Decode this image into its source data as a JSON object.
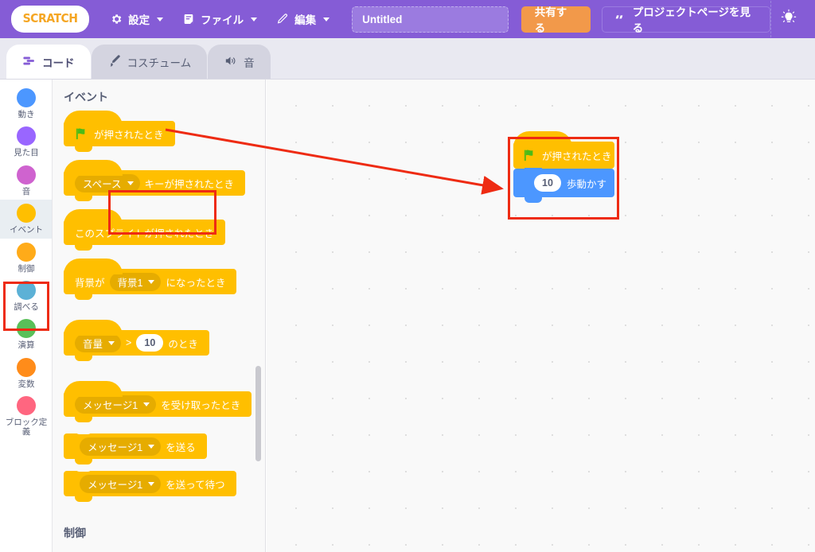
{
  "menubar": {
    "logo": "SCRATCH",
    "items": [
      {
        "label": "設定",
        "icon": "gear-icon"
      },
      {
        "label": "ファイル",
        "icon": "file-icon"
      },
      {
        "label": "編集",
        "icon": "pencil-icon"
      }
    ],
    "project_title": "Untitled",
    "project_title_placeholder": "Untitled",
    "share_label": "共有する",
    "project_page_label": "プロジェクトページを見る",
    "bulb_icon": "lightbulb-icon",
    "bg_color": "#855CD6",
    "share_color": "#F2994A"
  },
  "tabs": [
    {
      "label": "コード",
      "icon": "code-icon",
      "active": true
    },
    {
      "label": "コスチューム",
      "icon": "brush-icon",
      "active": false
    },
    {
      "label": "音",
      "icon": "speaker-icon",
      "active": false
    }
  ],
  "categories": [
    {
      "label": "動き",
      "color": "#4C97FF"
    },
    {
      "label": "見た目",
      "color": "#9966FF"
    },
    {
      "label": "音",
      "color": "#CF63CF"
    },
    {
      "label": "イベント",
      "color": "#FFBF00",
      "selected": true
    },
    {
      "label": "制御",
      "color": "#FFAB19"
    },
    {
      "label": "調べる",
      "color": "#5CB1D6"
    },
    {
      "label": "演算",
      "color": "#59C059"
    },
    {
      "label": "変数",
      "color": "#FF8C1A"
    },
    {
      "label": "ブロック定義",
      "color": "#FF6680"
    }
  ],
  "palette": {
    "header": "イベント",
    "footer_header": "制御",
    "blocks": {
      "flag_clicked": {
        "text": "が押されたとき",
        "icon": "green-flag-icon"
      },
      "key_pressed": {
        "dropdown": "スペース",
        "text": "キーが押されたとき"
      },
      "sprite_clicked": {
        "text": "このスプライトが押されたとき"
      },
      "backdrop_switch": {
        "prefix": "背景が",
        "dropdown": "背景1",
        "suffix": "になったとき"
      },
      "greater_than": {
        "dropdown": "音量",
        "operator": ">",
        "value": "10",
        "suffix": "のとき"
      },
      "receive_message": {
        "dropdown": "メッセージ1",
        "text": "を受け取ったとき"
      },
      "broadcast": {
        "dropdown": "メッセージ1",
        "text": "を送る"
      },
      "broadcast_wait": {
        "dropdown": "メッセージ1",
        "text": "を送って待つ"
      }
    }
  },
  "workspace": {
    "script": {
      "hat": {
        "text": "が押されたとき",
        "icon": "green-flag-icon",
        "color": "#FFBF00"
      },
      "move": {
        "value": "10",
        "text": "歩動かす",
        "color": "#4C97FF"
      }
    },
    "annotation_color": "#EE2B13"
  }
}
